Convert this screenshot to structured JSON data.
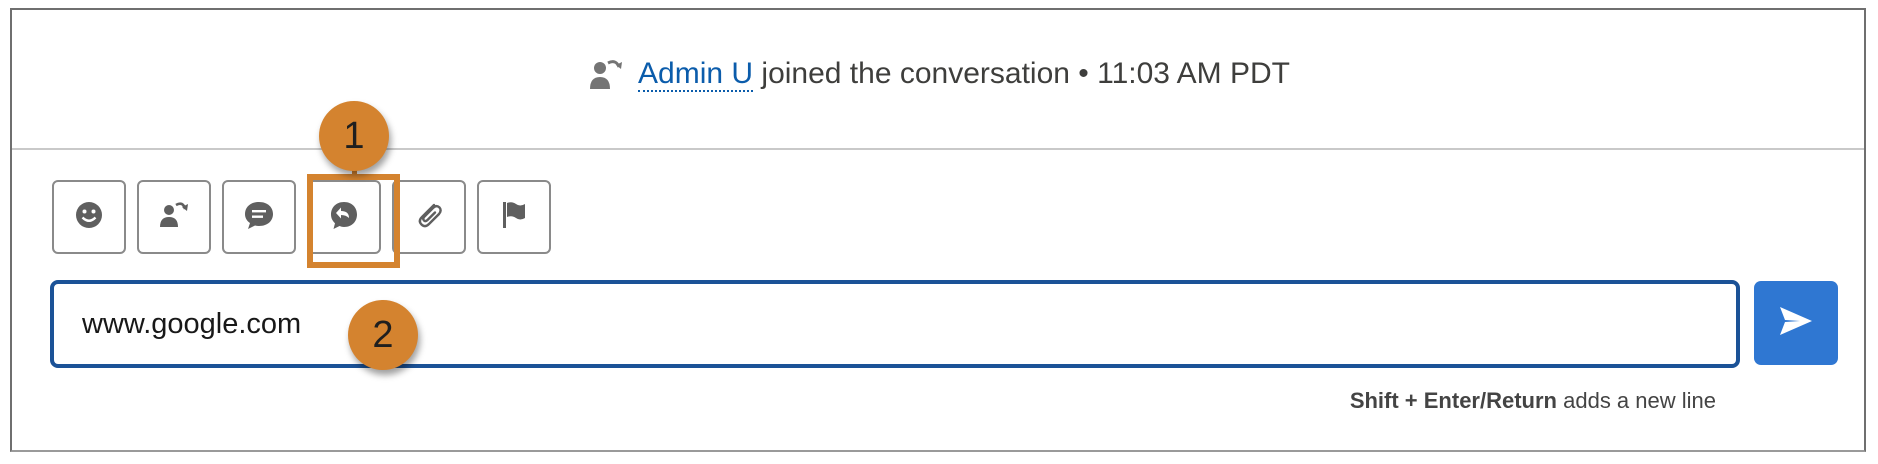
{
  "event": {
    "icon": "transfer-user-icon",
    "agent_name": "Admin U",
    "text": " joined the conversation • 11:03 AM PDT"
  },
  "toolbar": {
    "buttons": [
      {
        "icon": "emoji-icon"
      },
      {
        "icon": "transfer-icon"
      },
      {
        "icon": "quick-text-icon"
      },
      {
        "icon": "knowledge-share-icon"
      },
      {
        "icon": "attachment-icon"
      },
      {
        "icon": "flag-icon"
      }
    ]
  },
  "callouts": {
    "first": "1",
    "second": "2"
  },
  "composer": {
    "value": "www.google.com",
    "send_icon": "send-icon"
  },
  "hint": {
    "keys": "Shift + Enter/Return",
    "rest": " adds a new line"
  },
  "colors": {
    "accent": "#d4832f",
    "input_border": "#1b5297",
    "send_button": "#2f77d2",
    "link": "#0b5cab"
  }
}
